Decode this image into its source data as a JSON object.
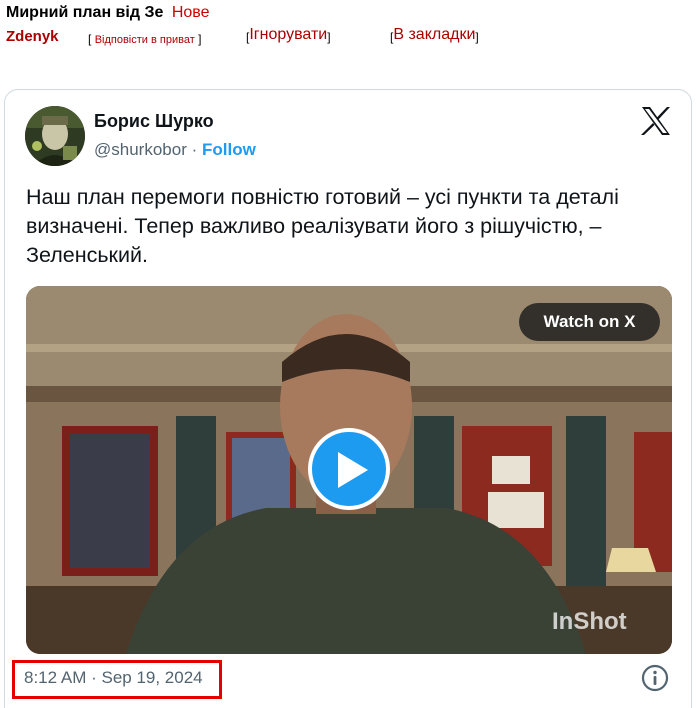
{
  "topic": {
    "title": "Мирний план від Зе",
    "new_badge": "Нове"
  },
  "post_actions": {
    "author": "Zdenyk",
    "reply_private": "Відповісти в приват",
    "ignore": "Ігнорувати",
    "bookmark": "В закладки",
    "bracket_open": "[",
    "bracket_close": "]"
  },
  "tweet": {
    "display_name": "Борис Шурко",
    "handle": "@shurkobor",
    "separator": "·",
    "follow_label": "Follow",
    "text": "Наш план перемоги повністю готовий – усі пункти та деталі визначені. Тепер важливо реалізувати його з рішучістю, – Зеленський.",
    "media": {
      "watch_label": "Watch on X",
      "watermark": "InShot"
    },
    "timestamp": "8:12 AM · Sep 19, 2024",
    "icons": {
      "x_logo": "x-logo-icon",
      "play": "play-icon",
      "info": "info-icon"
    }
  },
  "colors": {
    "accent": "#1d9bf0",
    "link_red": "#aa0000",
    "highlight_red": "#e60000",
    "muted": "#536471"
  }
}
